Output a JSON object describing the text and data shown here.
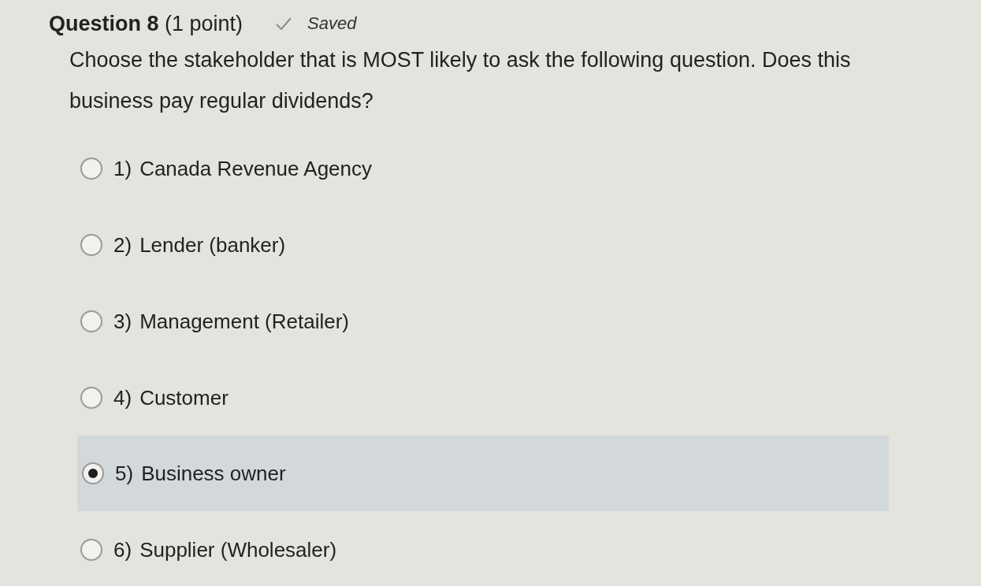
{
  "question": {
    "title": "**Question 8** (1 point)",
    "status": "Saved",
    "saved": true,
    "text": "Choose the stakeholder that is MOST likely to ask the following question. Does this business pay regular dividends?"
  },
  "options": [
    {
      "number": "1)",
      "label": "Canada Revenue Agency",
      "selected": false
    },
    {
      "number": "2)",
      "label": "Lender (banker)",
      "selected": false
    },
    {
      "number": "3)",
      "label": "Management (Retailer)",
      "selected": false
    },
    {
      "number": "4)",
      "label": "Customer",
      "selected": false
    },
    {
      "number": "5)",
      "label": "Business owner",
      "selected": true
    },
    {
      "number": "6)",
      "label": "Supplier (Wholesaler)",
      "selected": false
    }
  ]
}
